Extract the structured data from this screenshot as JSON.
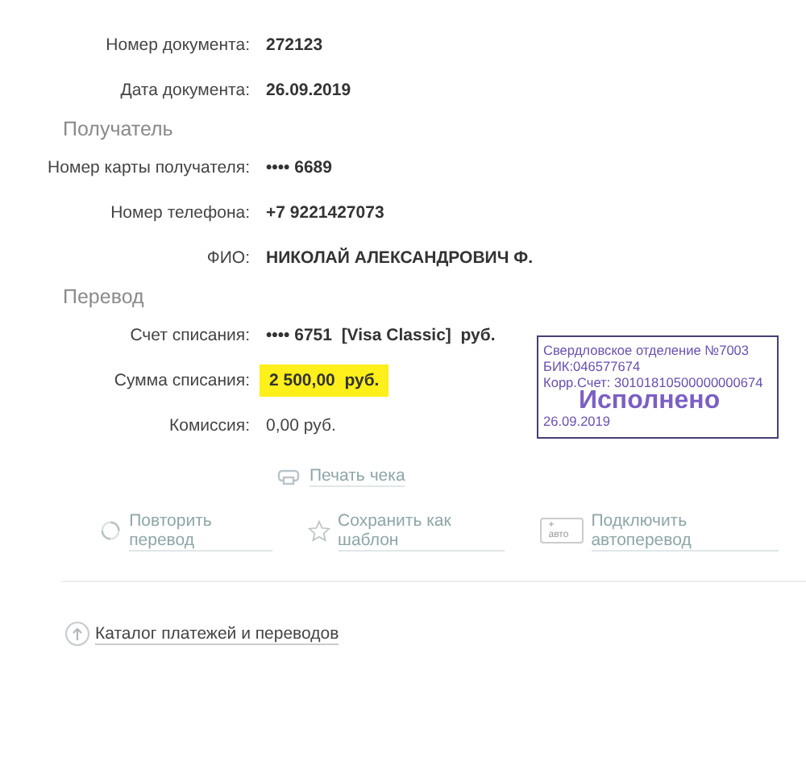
{
  "sections": [
    {
      "rows": [
        {
          "label": "Номер документа:",
          "value": "272123",
          "kind": "bold"
        },
        {
          "label": "Дата документа:",
          "value": "26.09.2019",
          "kind": "bold"
        }
      ]
    },
    {
      "title": "Получатель",
      "rows": [
        {
          "label": "Номер карты получателя:",
          "value": "•••• 6689",
          "kind": "bold"
        },
        {
          "label": "Номер телефона:",
          "value": "+7 9221427073",
          "kind": "bold"
        },
        {
          "label": "ФИО:",
          "value": "НИКОЛАЙ АЛЕКСАНДРОВИЧ Ф.",
          "kind": "bold"
        }
      ]
    },
    {
      "title": "Перевод",
      "rows": [
        {
          "label": "Счет списания:",
          "value": "•••• 6751  [Visa Classic]  руб.",
          "kind": "bold"
        },
        {
          "label": "Сумма списания:",
          "value": "2 500,00  руб.",
          "kind": "highlight"
        },
        {
          "label": "Комиссия:",
          "value": "0,00 руб.",
          "kind": "plain"
        }
      ]
    }
  ],
  "stamp": {
    "lines": [
      "Свердловское отделение №7003",
      "БИК:046577674",
      "Корр.Счет: 30101810500000000674"
    ],
    "status": "Исполнено",
    "date": "26.09.2019"
  },
  "print_link": "Печать чека",
  "actions": [
    {
      "kind": "repeat",
      "label": "Повторить перевод"
    },
    {
      "kind": "template",
      "label": "Сохранить как шаблон"
    },
    {
      "kind": "auto",
      "badge": "+ авто",
      "label": "Подключить автоперевод"
    }
  ],
  "catalog_link": "Каталог платежей и переводов"
}
